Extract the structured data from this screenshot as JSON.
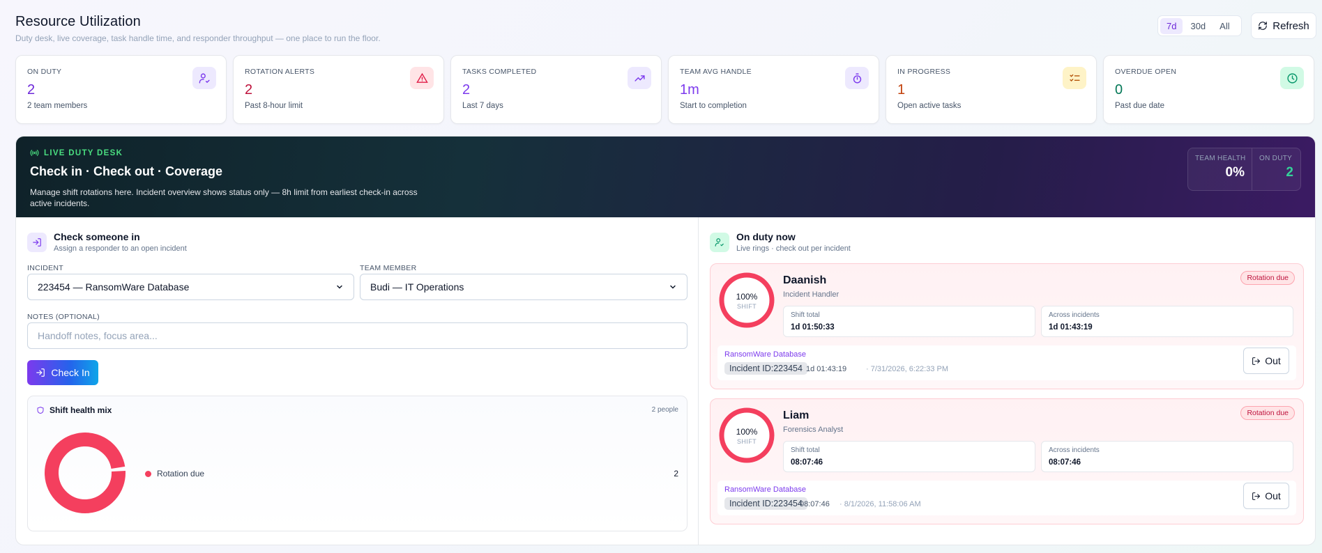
{
  "header": {
    "title": "Resource Utilization",
    "subtitle": "Duty desk, live coverage, task handle time, and responder throughput — one place to run the floor."
  },
  "range": [
    "7d",
    "30d",
    "All"
  ],
  "refresh_label": "Refresh",
  "kpis": [
    {
      "label": "ON DUTY",
      "value": "2",
      "sub": "2 team members",
      "color": "#6d28d9",
      "icon_bg": "#ede9fe",
      "icon": "user-check-icon"
    },
    {
      "label": "ROTATION ALERTS",
      "value": "2",
      "sub": "Past 8-hour limit",
      "color": "#be123c",
      "icon_bg": "#ffe4e6",
      "icon": "alert-triangle-icon"
    },
    {
      "label": "TASKS COMPLETED",
      "value": "2",
      "sub": "Last 7 days",
      "color": "#7c3aed",
      "icon_bg": "#ede9fe",
      "icon": "trending-up-icon"
    },
    {
      "label": "TEAM AVG HANDLE",
      "value": "1m",
      "sub": "Start to completion",
      "color": "#7c3aed",
      "icon_bg": "#ede9fe",
      "icon": "timer-icon"
    },
    {
      "label": "IN PROGRESS",
      "value": "1",
      "sub": "Open active tasks",
      "color": "#c2410c",
      "icon_bg": "#fef3c7",
      "icon": "list-checks-icon"
    },
    {
      "label": "OVERDUE OPEN",
      "value": "0",
      "sub": "Past due date",
      "color": "#047857",
      "icon_bg": "#d1fae5",
      "icon": "clock-icon"
    }
  ],
  "banner": {
    "tag": "LIVE DUTY DESK",
    "title": "Check in · Check out · Coverage",
    "desc": "Manage shift rotations here. Incident overview shows status only — 8h limit from earliest check-in across active incidents.",
    "health_label": "TEAM HEALTH",
    "health_value": "0%",
    "onduty_label": "ON DUTY",
    "onduty_value": "2"
  },
  "checkin": {
    "title": "Check someone in",
    "subtitle": "Assign a responder to an open incident",
    "incident_label": "INCIDENT",
    "incident_value": "223454 — RansomWare Database",
    "member_label": "TEAM MEMBER",
    "member_value": "Budi — IT Operations",
    "notes_label": "NOTES (OPTIONAL)",
    "notes_placeholder": "Handoff notes, focus area...",
    "button": "Check In"
  },
  "mix": {
    "title": "Shift health mix",
    "count": "2 people",
    "legend": [
      {
        "label": "Rotation due",
        "value": "2",
        "color": "#f43f5e"
      }
    ]
  },
  "onduty": {
    "title": "On duty now",
    "subtitle": "Live rings · check out per incident",
    "people": [
      {
        "name": "Daanish",
        "role": "Incident Handler",
        "pct": "100%",
        "shift_label": "SHIFT",
        "badge": "Rotation due",
        "shift_total_label": "Shift total",
        "shift_total": "1d 01:50:33",
        "across_label": "Across incidents",
        "across": "1d 01:43:19",
        "incident_name": "RansomWare Database",
        "incident_id": "Incident ID:223454",
        "elapsed": "1d 01:43:19",
        "when": "· 7/31/2026, 6:22:33 PM",
        "out": "Out"
      },
      {
        "name": "Liam",
        "role": "Forensics Analyst",
        "pct": "100%",
        "shift_label": "SHIFT",
        "badge": "Rotation due",
        "shift_total_label": "Shift total",
        "shift_total": "08:07:46",
        "across_label": "Across incidents",
        "across": "08:07:46",
        "incident_name": "RansomWare Database",
        "incident_id": "Incident ID:223454",
        "elapsed": "08:07:46",
        "when": "· 8/1/2026, 11:58:06 AM",
        "out": "Out"
      }
    ]
  }
}
